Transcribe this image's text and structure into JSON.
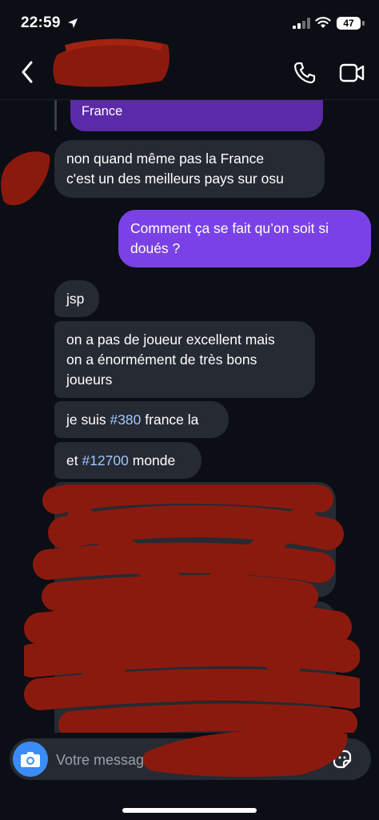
{
  "status": {
    "time": "22:59",
    "battery": "47"
  },
  "header": {
    "contact_name": ""
  },
  "quoted": {
    "text": "France"
  },
  "messages": {
    "m1_line1": "non quand même pas la France",
    "m1_line2": "c'est un des meilleurs pays sur osu",
    "m2_line1": "Comment ça se fait qu’on soit si",
    "m2_line2": "doués ?",
    "m3": "jsp",
    "m4_line1": "on a pas de joueur excellent mais",
    "m4_line2": "on a énormément de très bons",
    "m4_line3": "joueurs",
    "m5_pre": "je suis ",
    "m5_tag": "#380",
    "m5_post": " france la",
    "m6_pre": "et ",
    "m6_tag": "#12700",
    "m6_post": " monde"
  },
  "composer": {
    "placeholder": "Votre message..."
  },
  "colors": {
    "background": "#0b0e14",
    "incoming_bubble": "#262a33",
    "outgoing_bubble": "#7a42e6",
    "quoted_bubble": "#5b2aa8",
    "hashtag": "#9cc8ff",
    "camera_button": "#3a8cf7",
    "redaction": "#8b1a0e"
  },
  "icons": [
    "location-arrow-icon",
    "signal-icon",
    "wifi-icon",
    "battery-icon",
    "back-chevron-icon",
    "phone-icon",
    "video-camera-icon",
    "camera-icon",
    "microphone-icon",
    "gallery-icon",
    "sticker-icon"
  ]
}
